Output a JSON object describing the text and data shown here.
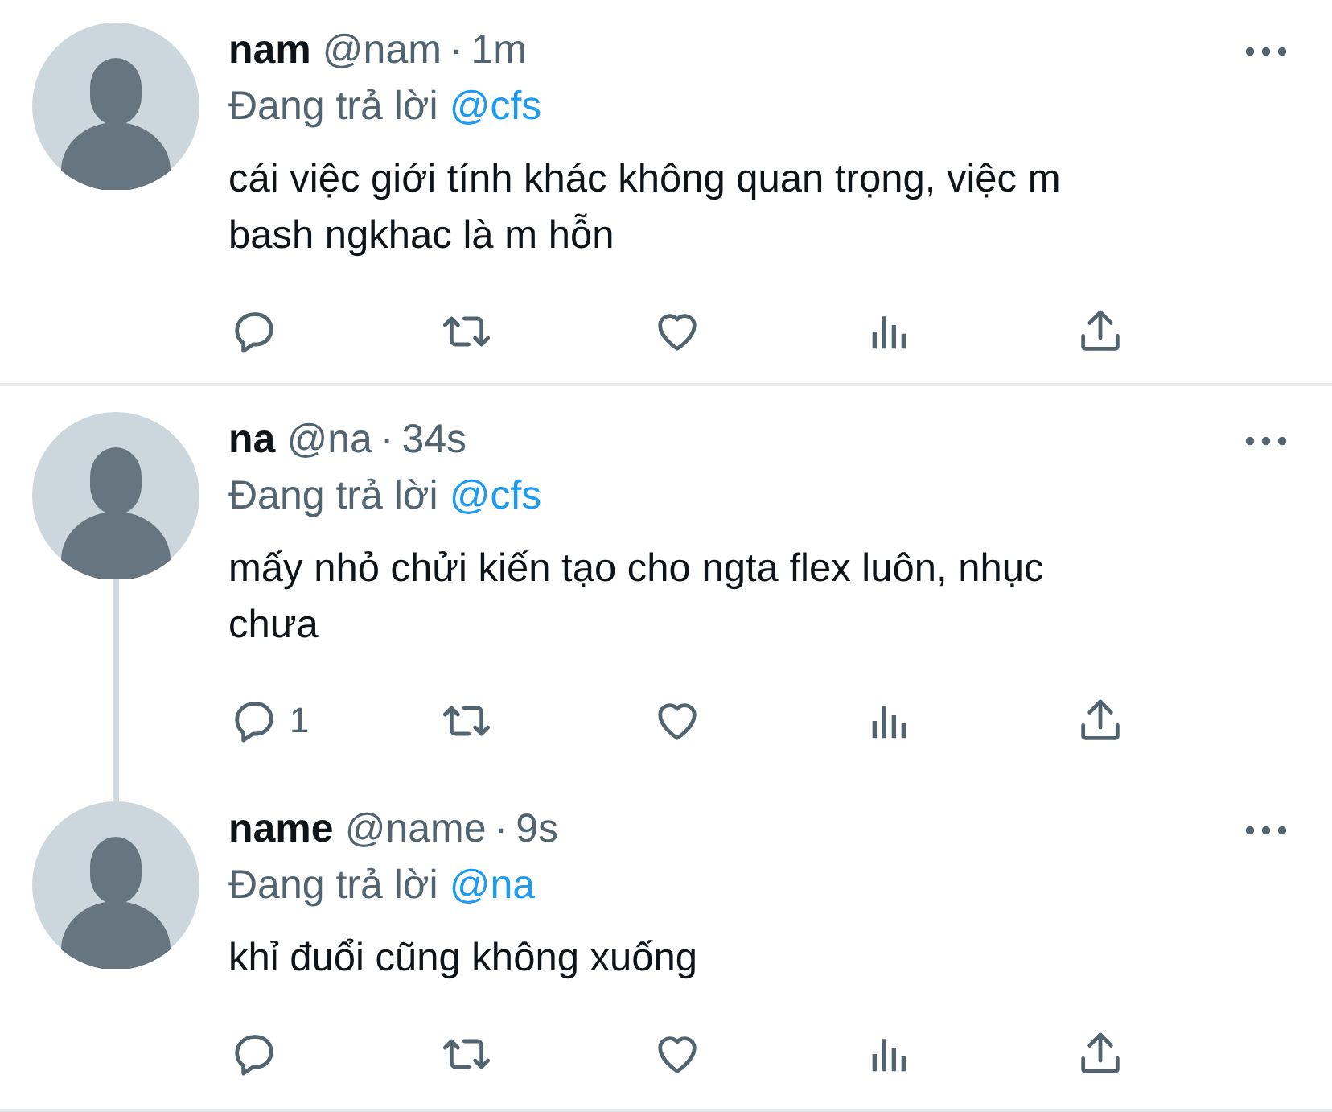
{
  "tweets": [
    {
      "name": "nam",
      "handle": "@nam",
      "separator": "·",
      "time": "1m",
      "reply_label": "Đang trả lời",
      "reply_to": "@cfs",
      "text": "cái việc giới tính khác không quan trọng, việc m bash ngkhac là m hỗn",
      "connects_next": false
    },
    {
      "name": "na",
      "handle": "@na",
      "separator": "·",
      "time": "34s",
      "reply_label": "Đang trả lời",
      "reply_to": "@cfs",
      "text": "mấy nhỏ chửi kiến tạo cho ngta flex luôn, nhục chưa",
      "reply_count": "1",
      "connects_next": true
    },
    {
      "name": "name",
      "handle": "@name",
      "separator": "·",
      "time": "9s",
      "reply_label": "Đang trả lời",
      "reply_to": "@na",
      "text": "khỉ đuổi cũng không xuống",
      "connects_next": false
    }
  ]
}
